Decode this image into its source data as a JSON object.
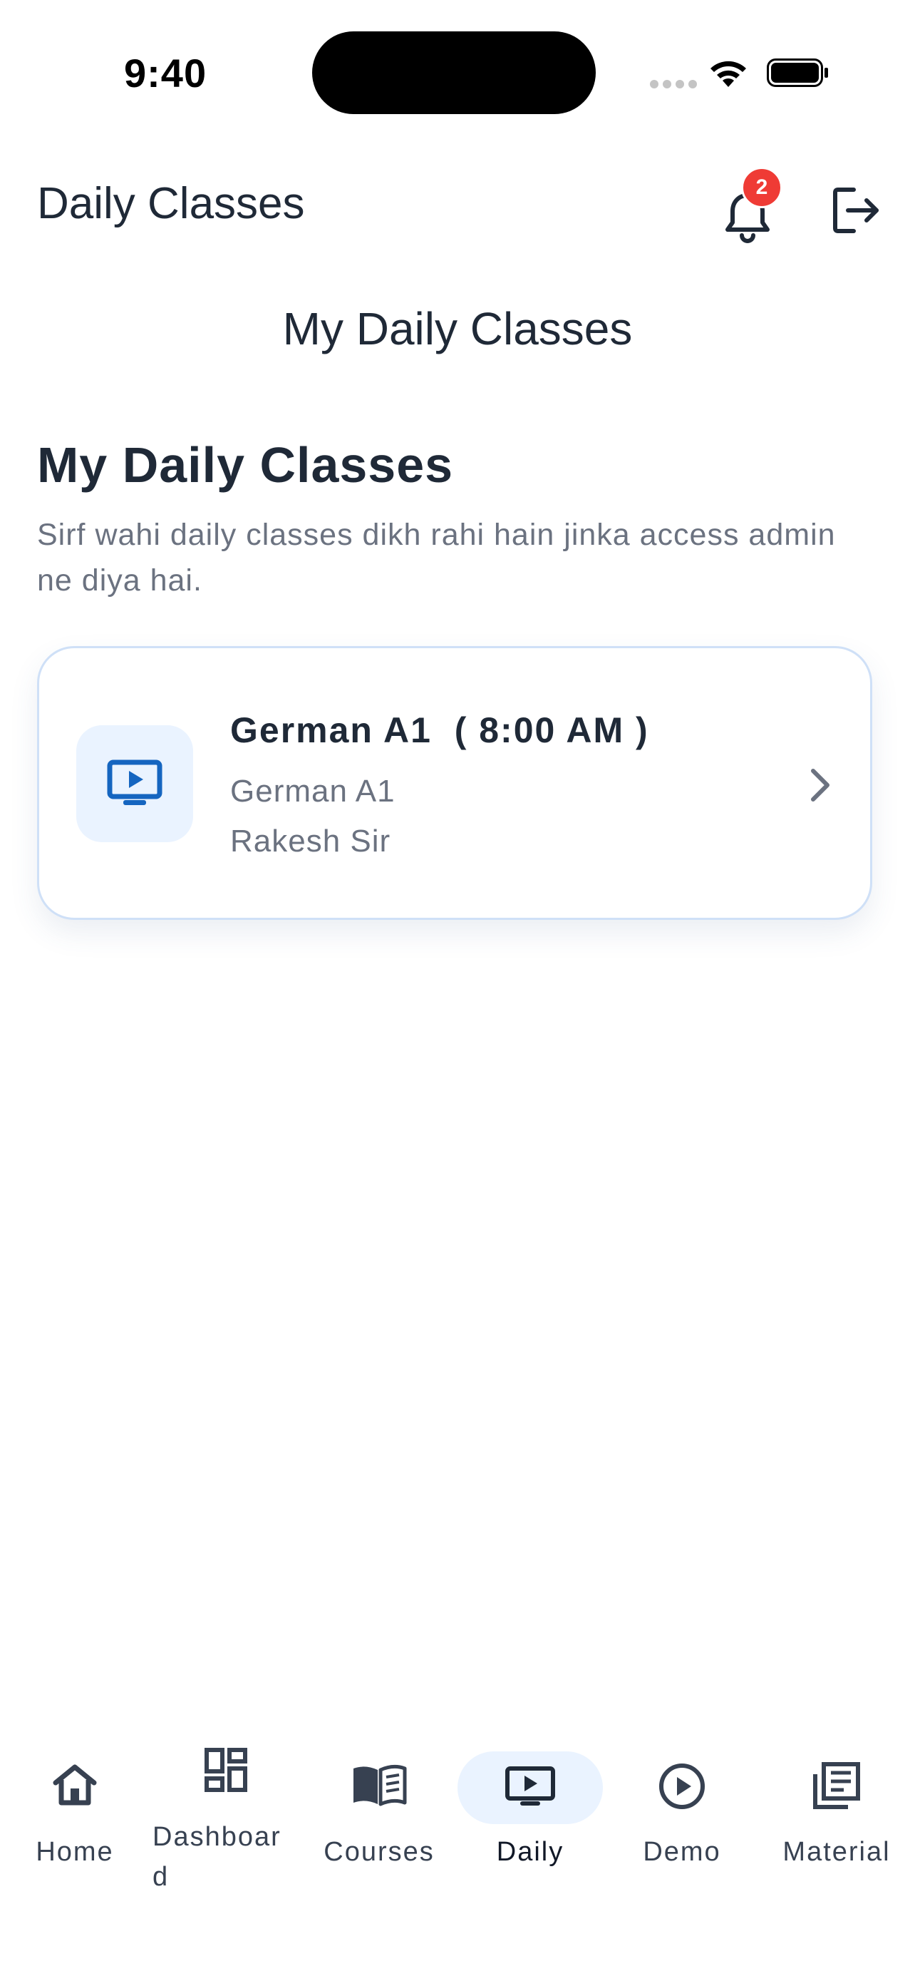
{
  "status_bar": {
    "time": "9:40"
  },
  "app_bar": {
    "title": "Daily Classes",
    "notification_count": "2"
  },
  "page": {
    "subtitle": "My Daily Classes",
    "section_title": "My Daily Classes",
    "section_description": "Sirf wahi daily classes dikh rahi hain jinka access admin ne diya hai."
  },
  "classes": [
    {
      "title": "German A1  ( 8:00 AM )",
      "course": "German A1",
      "teacher": "Rakesh Sir"
    }
  ],
  "bottom_nav": {
    "items": [
      {
        "label": "Home",
        "icon": "home-icon"
      },
      {
        "label": "Dashboar\nd",
        "icon": "dashboard-icon"
      },
      {
        "label": "Courses",
        "icon": "book-icon"
      },
      {
        "label": "Daily",
        "icon": "tv-play-icon"
      },
      {
        "label": "Demo",
        "icon": "play-circle-icon"
      },
      {
        "label": "Material",
        "icon": "library-icon"
      }
    ],
    "active": "Daily"
  },
  "colors": {
    "accent": "#1565c0",
    "accent_light": "#eaf3ff",
    "badge": "#ef3b35",
    "text_primary": "#1f2937",
    "text_secondary": "#6b7280"
  }
}
